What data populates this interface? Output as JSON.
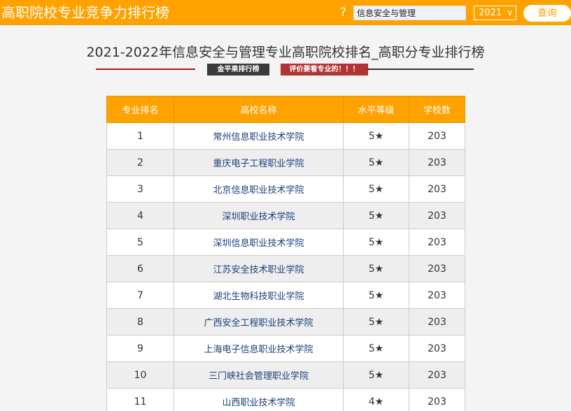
{
  "header": {
    "brand": "高职院校专业竞争力排行榜",
    "help_icon": "?",
    "search_value": "信息安全与管理",
    "year": "2021",
    "year_chevron": "∨",
    "query_label": "查询"
  },
  "main": {
    "title": "2021-2022年信息安全与管理专业高职院校排名_高职分专业排行榜",
    "badge_dark": "金平果排行榜",
    "badge_red": "评价要看专业的！！！"
  },
  "table": {
    "headers": [
      "专业排名",
      "高校名称",
      "水平等级",
      "学校数"
    ],
    "rows": [
      {
        "rank": "1",
        "school": "常州信息职业技术学院",
        "level": "5★",
        "count": "203"
      },
      {
        "rank": "2",
        "school": "重庆电子工程职业学院",
        "level": "5★",
        "count": "203"
      },
      {
        "rank": "3",
        "school": "北京信息职业技术学院",
        "level": "5★",
        "count": "203"
      },
      {
        "rank": "4",
        "school": "深圳职业技术学院",
        "level": "5★",
        "count": "203"
      },
      {
        "rank": "5",
        "school": "深圳信息职业技术学院",
        "level": "5★",
        "count": "203"
      },
      {
        "rank": "6",
        "school": "江苏安全技术职业学院",
        "level": "5★",
        "count": "203"
      },
      {
        "rank": "7",
        "school": "湖北生物科技职业学院",
        "level": "5★",
        "count": "203"
      },
      {
        "rank": "8",
        "school": "广西安全工程职业技术学院",
        "level": "5★",
        "count": "203"
      },
      {
        "rank": "9",
        "school": "上海电子信息职业技术学院",
        "level": "5★",
        "count": "203"
      },
      {
        "rank": "10",
        "school": "三门峡社会管理职业学院",
        "level": "5★",
        "count": "203"
      },
      {
        "rank": "11",
        "school": "山西职业技术学院",
        "level": "4★",
        "count": "203"
      }
    ]
  },
  "colors": {
    "accent": "#ffa200",
    "link": "#1b3f7a",
    "badge_red": "#b03434",
    "badge_dark": "#3a3a3a"
  }
}
